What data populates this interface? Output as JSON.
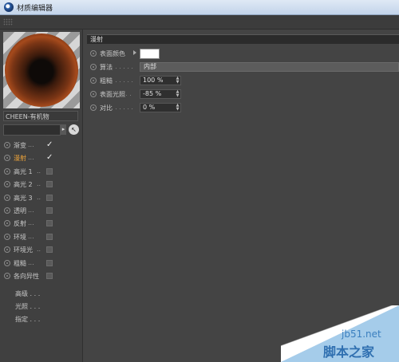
{
  "window": {
    "title": "材质编辑器"
  },
  "material": {
    "name": "CHEEN-有机物"
  },
  "channels": [
    {
      "label": "渐变",
      "dots": "...",
      "checked": true,
      "active": false
    },
    {
      "label": "漫射",
      "dots": "...",
      "checked": true,
      "active": true
    },
    {
      "label": "高光 1",
      "dots": "..",
      "checked": false,
      "active": false
    },
    {
      "label": "高光 2",
      "dots": "..",
      "checked": false,
      "active": false
    },
    {
      "label": "高光 3",
      "dots": "..",
      "checked": false,
      "active": false
    },
    {
      "label": "透明",
      "dots": "...",
      "checked": false,
      "active": false
    },
    {
      "label": "反射",
      "dots": "...",
      "checked": false,
      "active": false
    },
    {
      "label": "环境",
      "dots": "...",
      "checked": false,
      "active": false
    },
    {
      "label": "环境光",
      "dots": "..",
      "checked": false,
      "active": false
    },
    {
      "label": "粗糙",
      "dots": "...",
      "checked": false,
      "active": false
    },
    {
      "label": "各向异性",
      "dots": "",
      "checked": false,
      "active": false
    }
  ],
  "extras": [
    {
      "label": "高级 . . ."
    },
    {
      "label": "光照 . . ."
    },
    {
      "label": "指定 . . ."
    }
  ],
  "section": {
    "title": "漫射"
  },
  "properties": {
    "color": {
      "label": "表面颜色",
      "dots": "",
      "value": "#ffffff"
    },
    "algorithm": {
      "label": "算法",
      "dots": ". . . . . .",
      "value": "内部"
    },
    "roughness": {
      "label": "粗糙",
      "dots": ". . . . . .",
      "value": "100 %"
    },
    "surface_light": {
      "label": "表面光照",
      "dots": ". .",
      "value": "-85 %"
    },
    "contrast": {
      "label": "对比",
      "dots": ". . . . . .",
      "value": "0 %"
    }
  },
  "watermark": {
    "url": "jb51.net",
    "name": "脚本之家"
  }
}
